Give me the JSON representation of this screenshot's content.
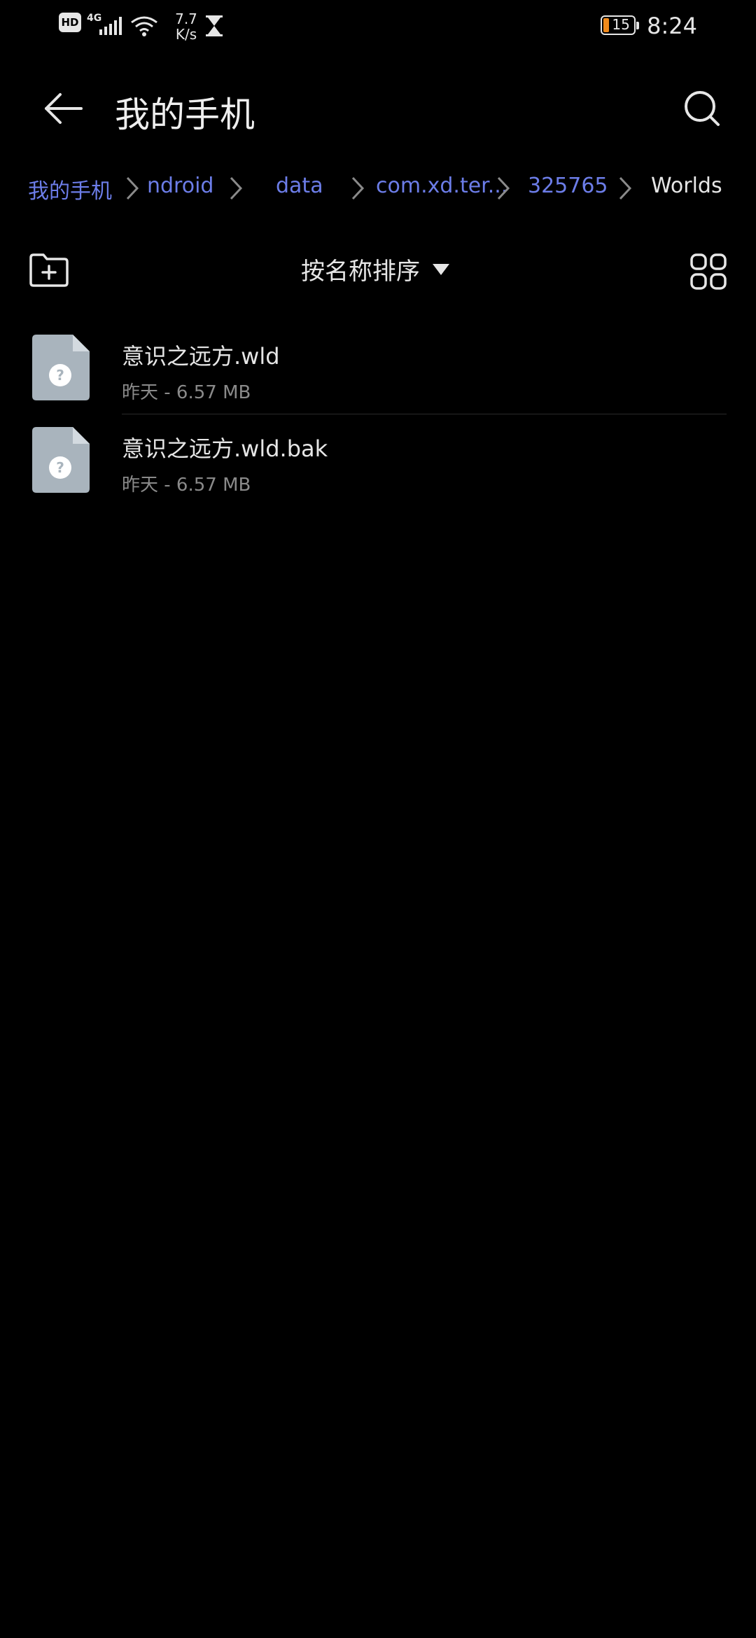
{
  "status_bar": {
    "hd_label": "HD",
    "network_label": "4G",
    "speed_value": "7.7",
    "speed_unit": "K/s",
    "battery_level": "15",
    "time": "8:24",
    "battery_fill_color": "#f08a1c"
  },
  "header": {
    "title": "我的手机",
    "back_icon": "back-arrow-icon",
    "search_icon": "search-icon"
  },
  "breadcrumb": {
    "items": [
      {
        "label": "我的手机"
      },
      {
        "label": "ndroid"
      },
      {
        "label": "data"
      },
      {
        "label": "com.xd.ter..."
      },
      {
        "label": "325765"
      },
      {
        "label": "Worlds"
      }
    ],
    "link_color": "#6c7de8"
  },
  "toolbar": {
    "sort_label": "按名称排序",
    "new_folder_icon": "new-folder-icon",
    "grid_icon": "grid-view-icon"
  },
  "files": [
    {
      "name": "意识之远方.wld",
      "date": "昨天",
      "size": "6.57 MB",
      "meta": "昨天 - 6.57 MB"
    },
    {
      "name": "意识之远方.wld.bak",
      "date": "昨天",
      "size": "6.57 MB",
      "meta": "昨天 - 6.57 MB"
    }
  ]
}
